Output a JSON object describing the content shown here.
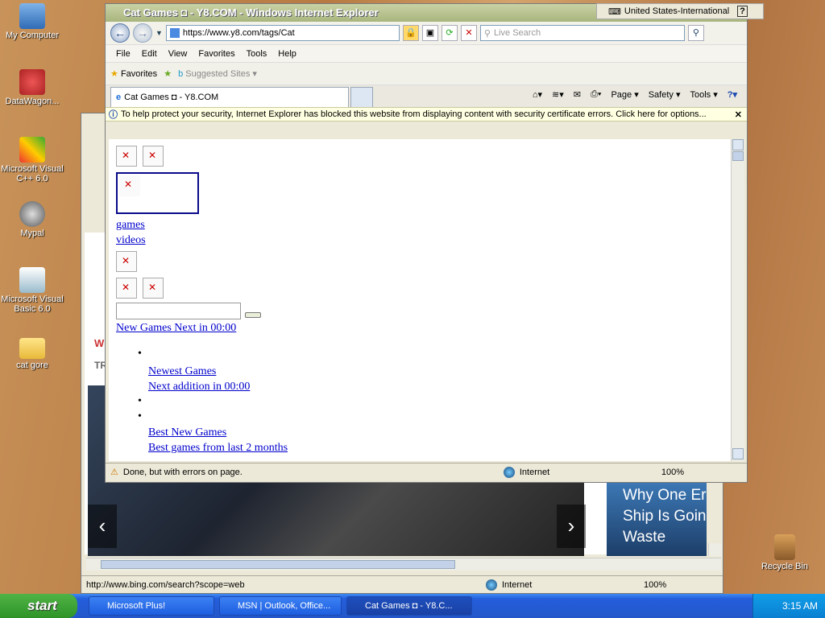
{
  "desktop": {
    "icons": [
      "My Computer",
      "DataWagon...",
      "Microsoft Visual C++ 6.0",
      "Mypal",
      "Microsoft Visual Basic 6.0",
      "cat gore",
      "Recycle Bin"
    ]
  },
  "ie_front": {
    "title": "Cat Games ◘ - Y8.COM - Windows Internet Explorer",
    "url": "https://www.y8.com/tags/Cat",
    "search_placeholder": "Live Search",
    "menu": [
      "File",
      "Edit",
      "View",
      "Favorites",
      "Tools",
      "Help"
    ],
    "favorites_label": "Favorites",
    "suggested_sites": "Suggested Sites",
    "tab_title": "Cat Games ◘ - Y8.COM",
    "commands": [
      "Page",
      "Safety",
      "Tools"
    ],
    "infobar": "To help protect your security, Internet Explorer has blocked this website from displaying content with security certificate errors. Click here for options...",
    "links": {
      "games": "games",
      "videos": "videos",
      "new_games_next": "New Games Next in  00:00",
      "newest_games": "Newest Games",
      "next_addition": "Next addition in 00:00",
      "best_new_games": "Best New Games",
      "best_games_last": "Best games from last 2 months"
    },
    "status": "Done, but with errors on page.",
    "zone": "Internet",
    "zoom": "100%"
  },
  "language_bar": "United States-International",
  "ie_back": {
    "status_url": "http://www.bing.com/search?scope=web",
    "zone": "Internet",
    "zoom": "100%",
    "headline": "Why One Er Ship Is Goin Waste",
    "frag_w": "W",
    "frag_tr": "TR"
  },
  "taskbar": {
    "start": "start",
    "tasks": [
      "Microsoft Plus!",
      "MSN | Outlook, Office...",
      "Cat Games ◘ - Y8.C..."
    ],
    "clock": "3:15 AM"
  },
  "colors": {
    "accent": "#245edc",
    "link": "#0000cc",
    "info": "#ffffe1"
  }
}
